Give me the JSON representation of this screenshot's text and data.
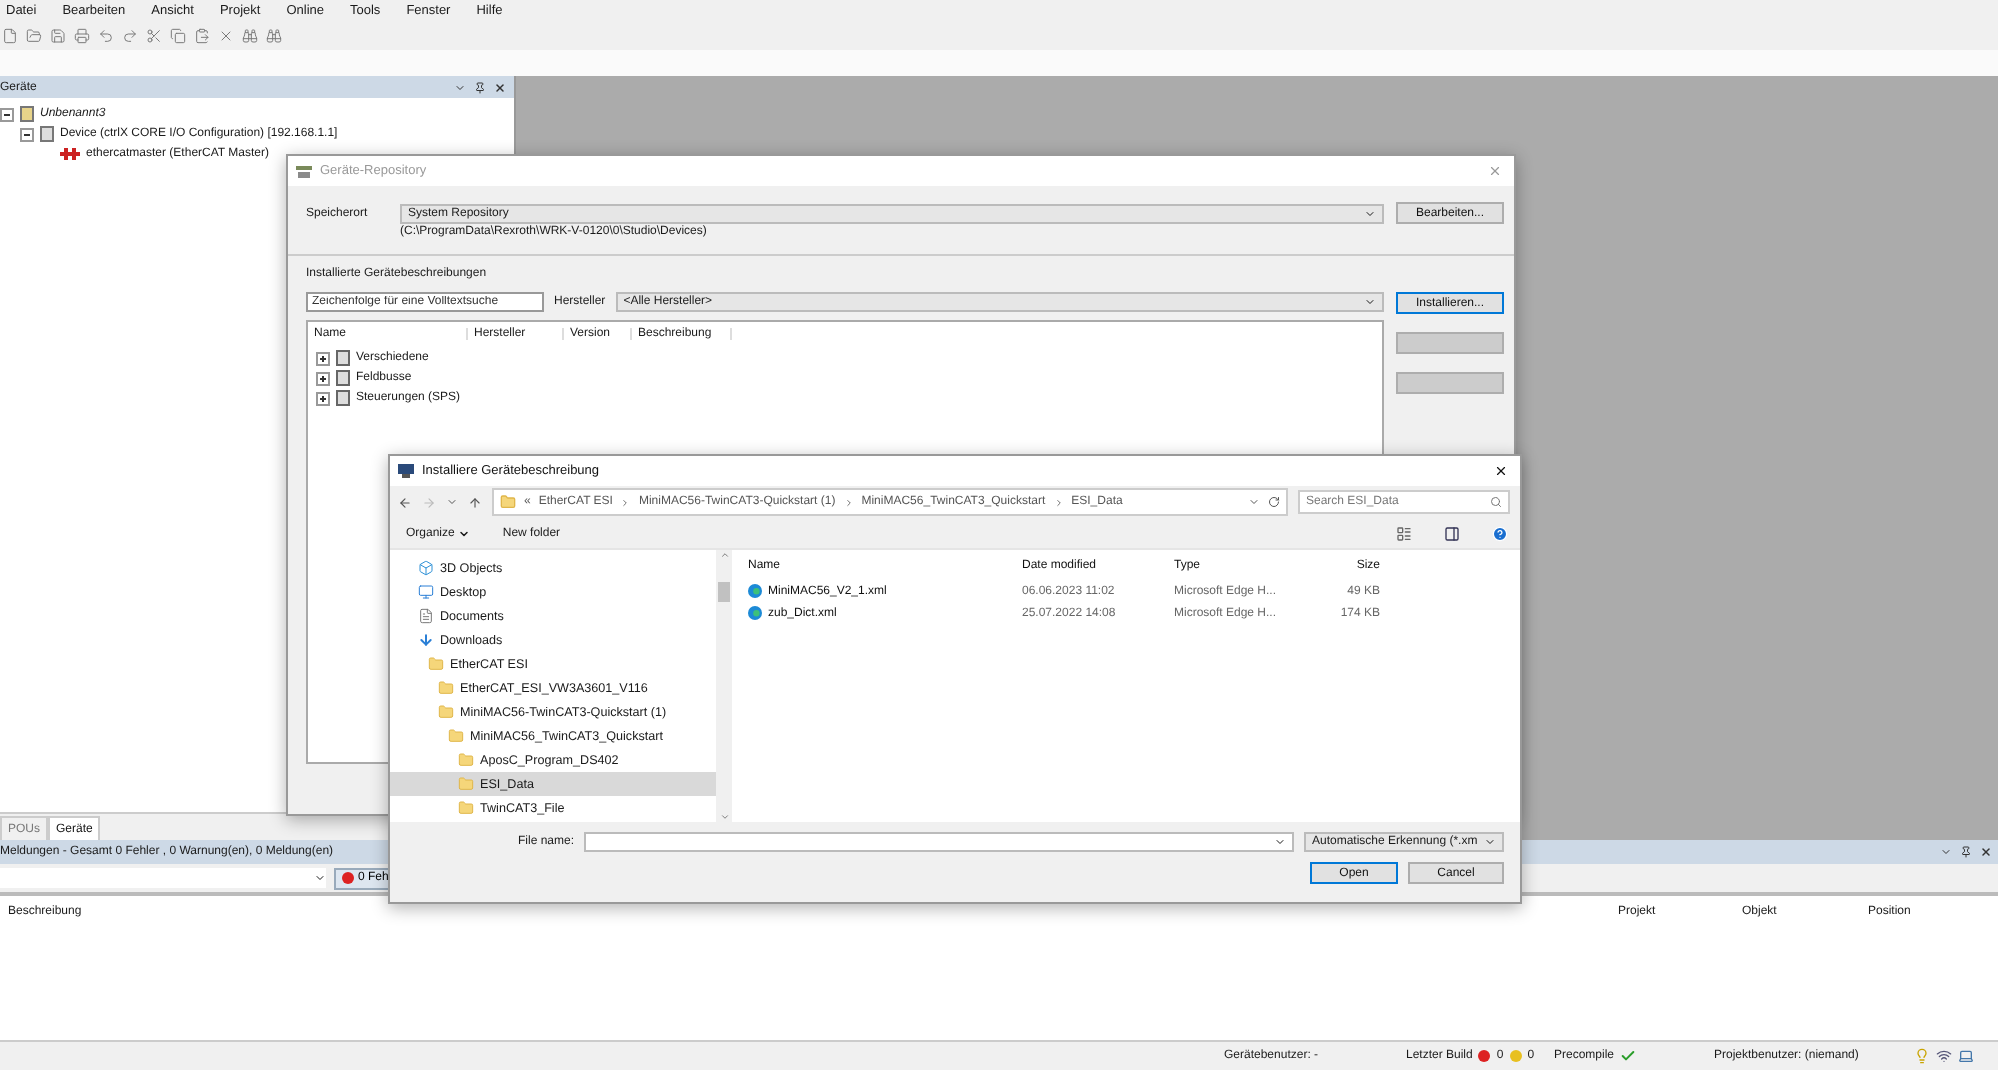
{
  "menu": [
    "Datei",
    "Bearbeiten",
    "Ansicht",
    "Projekt",
    "Online",
    "Tools",
    "Fenster",
    "Hilfe"
  ],
  "devices_panel": {
    "title": "Geräte",
    "tree": [
      {
        "label": "Unbenannt3",
        "expanded": true,
        "children": [
          {
            "label": "Device (ctrlX CORE I/O Configuration) [192.168.1.1]",
            "expanded": true,
            "children": [
              {
                "label": "ethercatmaster (EtherCAT Master)"
              }
            ]
          }
        ]
      }
    ],
    "tabs": [
      {
        "label": "POUs",
        "selected": false
      },
      {
        "label": "Geräte",
        "selected": true
      }
    ]
  },
  "messages": {
    "title": "Meldungen - Gesamt 0 Fehler , 0 Warnung(en), 0 Meldung(en)",
    "error_filter": "0 Feh",
    "columns": [
      "Beschreibung",
      "Projekt",
      "Objekt",
      "Position"
    ]
  },
  "status_bar": {
    "device_user": "Gerätebenutzer: -",
    "last_build": "Letzter Build",
    "errors": "0",
    "warnings": "0",
    "precompile": "Precompile",
    "project_user": "Projektbenutzer: (niemand)"
  },
  "repository_dialog": {
    "title": "Geräte-Repository",
    "location_label": "Speicherort",
    "location": "System Repository",
    "path": "(C:\\ProgramData\\Rexroth\\WRK-V-0120\\0\\Studio\\Devices)",
    "edit_button": "Bearbeiten...",
    "section": "Installierte Gerätebeschreibungen",
    "search_placeholder": "Zeichenfolge für eine Volltextsuche",
    "vendor_label": "Hersteller",
    "vendor": "<Alle Hersteller>",
    "buttons": [
      {
        "label": "Installieren...",
        "disabled": false
      },
      {
        "disabled": true
      },
      {
        "disabled": true
      }
    ],
    "columns": [
      "Name",
      "Hersteller",
      "Version",
      "Beschreibung"
    ],
    "rows": [
      {
        "label": "Verschiedene",
        "expanded": false
      },
      {
        "label": "Feldbusse",
        "expanded": false
      },
      {
        "label": "Steuerungen (SPS)",
        "expanded": false
      }
    ]
  },
  "file_dialog": {
    "title": "Installiere Gerätebeschreibung",
    "overflow": "«",
    "breadcrumb": [
      "EtherCAT ESI",
      "MiniMAC56-TwinCAT3-Quickstart (1)",
      "MiniMAC56_TwinCAT3_Quickstart",
      "ESI_Data"
    ],
    "search_placeholder": "Search ESI_Data",
    "organize": "Organize",
    "new_folder": "New folder",
    "nav": [
      {
        "label": "3D Objects",
        "kind": "objects",
        "selected": false
      },
      {
        "label": "Desktop",
        "kind": "desktop",
        "selected": false
      },
      {
        "label": "Documents",
        "kind": "documents",
        "selected": false
      },
      {
        "label": "Downloads",
        "kind": "downloads",
        "selected": false,
        "children": [
          {
            "label": "EtherCAT ESI",
            "kind": "folder",
            "selected": false,
            "children": [
              {
                "label": "EtherCAT_ESI_VW3A3601_V116",
                "kind": "folder",
                "selected": false
              },
              {
                "label": "MiniMAC56-TwinCAT3-Quickstart (1)",
                "kind": "folder",
                "selected": false,
                "children": [
                  {
                    "label": "MiniMAC56_TwinCAT3_Quickstart",
                    "kind": "folder",
                    "selected": false,
                    "children": [
                      {
                        "label": "AposC_Program_DS402",
                        "kind": "folder",
                        "selected": false
                      },
                      {
                        "label": "ESI_Data",
                        "kind": "folder",
                        "selected": true
                      },
                      {
                        "label": "TwinCAT3_File",
                        "kind": "folder",
                        "selected": false
                      }
                    ]
                  }
                ]
              }
            ]
          }
        ]
      }
    ],
    "columns": [
      "Name",
      "Date modified",
      "Type",
      "Size"
    ],
    "files": [
      {
        "name": "MiniMAC56_V2_1.xml",
        "date": "06.06.2023 11:02",
        "type": "Microsoft Edge H...",
        "size": "49 KB"
      },
      {
        "name": "zub_Dict.xml",
        "date": "25.07.2022 14:08",
        "type": "Microsoft Edge H...",
        "size": "174 KB"
      }
    ],
    "file_name_label": "File name:",
    "filter": "Automatische Erkennung (*.xm",
    "open": "Open",
    "cancel": "Cancel"
  }
}
